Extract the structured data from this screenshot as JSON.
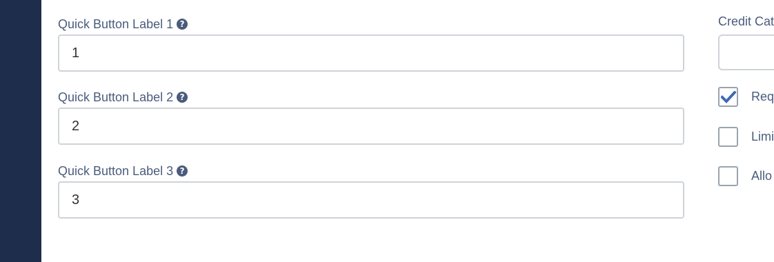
{
  "fields": [
    {
      "label": "Quick Button Label 1",
      "value": "1"
    },
    {
      "label": "Quick Button Label 2",
      "value": "2"
    },
    {
      "label": "Quick Button Label 3",
      "value": "3"
    }
  ],
  "help_icon_glyph": "?",
  "right_panel": {
    "credit_category_label": "Credit Cat",
    "credit_category_value": "",
    "checkboxes": [
      {
        "label": "Req",
        "checked": true
      },
      {
        "label": "Limi",
        "checked": false
      },
      {
        "label": "Allo",
        "checked": false
      }
    ]
  },
  "colors": {
    "sidebar": "#1f2d4d",
    "label_text": "#4a5c7c",
    "checkmark": "#3d6bb3"
  }
}
